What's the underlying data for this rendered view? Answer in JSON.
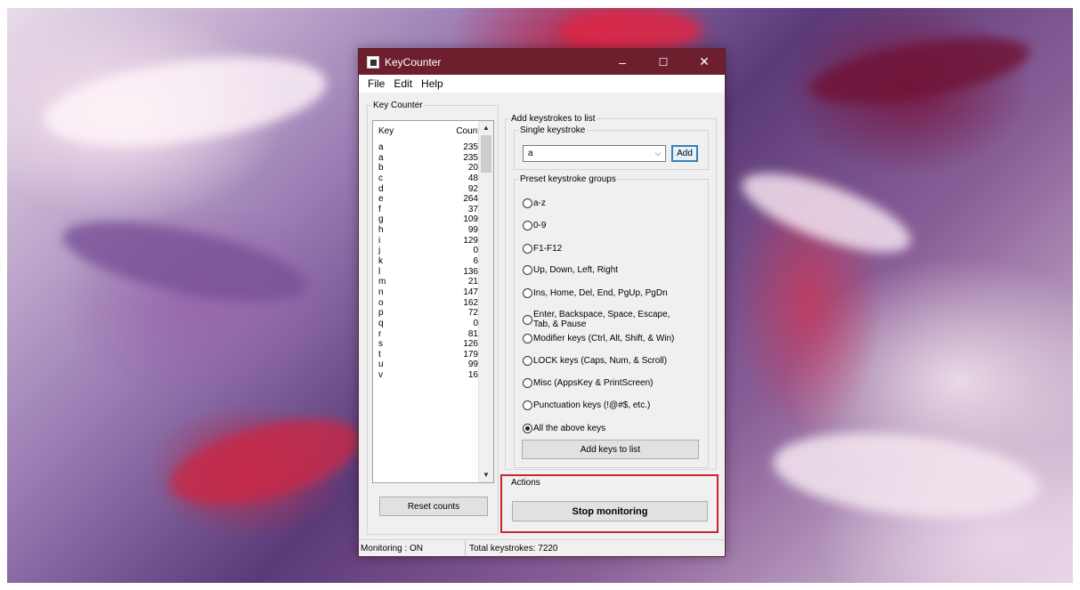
{
  "window": {
    "title": "KeyCounter",
    "controls": {
      "minimize": "–",
      "maximize": "☐",
      "close": "✕"
    }
  },
  "menu": [
    "File",
    "Edit",
    "Help"
  ],
  "key_counter": {
    "group_label": "Key Counter",
    "col_key": "Key",
    "col_count": "Count",
    "rows": [
      {
        "key": "a",
        "count": "235"
      },
      {
        "key": "a",
        "count": "235"
      },
      {
        "key": "b",
        "count": "20"
      },
      {
        "key": "c",
        "count": "48"
      },
      {
        "key": "d",
        "count": "92"
      },
      {
        "key": "e",
        "count": "264"
      },
      {
        "key": "f",
        "count": "37"
      },
      {
        "key": "g",
        "count": "109"
      },
      {
        "key": "h",
        "count": "99"
      },
      {
        "key": "i",
        "count": "129"
      },
      {
        "key": "j",
        "count": "0"
      },
      {
        "key": "k",
        "count": "6"
      },
      {
        "key": "l",
        "count": "136"
      },
      {
        "key": "m",
        "count": "21"
      },
      {
        "key": "n",
        "count": "147"
      },
      {
        "key": "o",
        "count": "162"
      },
      {
        "key": "p",
        "count": "72"
      },
      {
        "key": "q",
        "count": "0"
      },
      {
        "key": "r",
        "count": "81"
      },
      {
        "key": "s",
        "count": "126"
      },
      {
        "key": "t",
        "count": "179"
      },
      {
        "key": "u",
        "count": "99"
      },
      {
        "key": "v",
        "count": "16"
      }
    ],
    "reset_label": "Reset counts"
  },
  "add_keystrokes": {
    "group_label": "Add keystrokes to list",
    "single_label": "Single keystroke",
    "single_value": "a",
    "add_label": "Add",
    "preset_label": "Preset keystroke groups",
    "presets": [
      {
        "label": "a-z",
        "selected": false
      },
      {
        "label": "0-9",
        "selected": false
      },
      {
        "label": "F1-F12",
        "selected": false
      },
      {
        "label": "Up, Down, Left, Right",
        "selected": false
      },
      {
        "label": "Ins, Home, Del, End, PgUp, PgDn",
        "selected": false
      },
      {
        "label": "Enter, Backspace, Space, Escape,\nTab, & Pause",
        "selected": false
      },
      {
        "label": "Modifier keys (Ctrl, Alt, Shift, & Win)",
        "selected": false
      },
      {
        "label": "LOCK keys (Caps, Num, & Scroll)",
        "selected": false
      },
      {
        "label": "Misc (AppsKey & PrintScreen)",
        "selected": false
      },
      {
        "label": "Punctuation keys (!@#$, etc.)",
        "selected": false
      },
      {
        "label": "All the above keys",
        "selected": true
      }
    ],
    "add_to_list_label": "Add keys to list"
  },
  "actions": {
    "group_label": "Actions",
    "stop_label": "Stop monitoring",
    "highlight_color": "#c6282b"
  },
  "status": {
    "monitoring": "Monitoring : ON",
    "total": "Total keystrokes: 7220"
  },
  "colors": {
    "titlebar": "#6d1f2e"
  }
}
